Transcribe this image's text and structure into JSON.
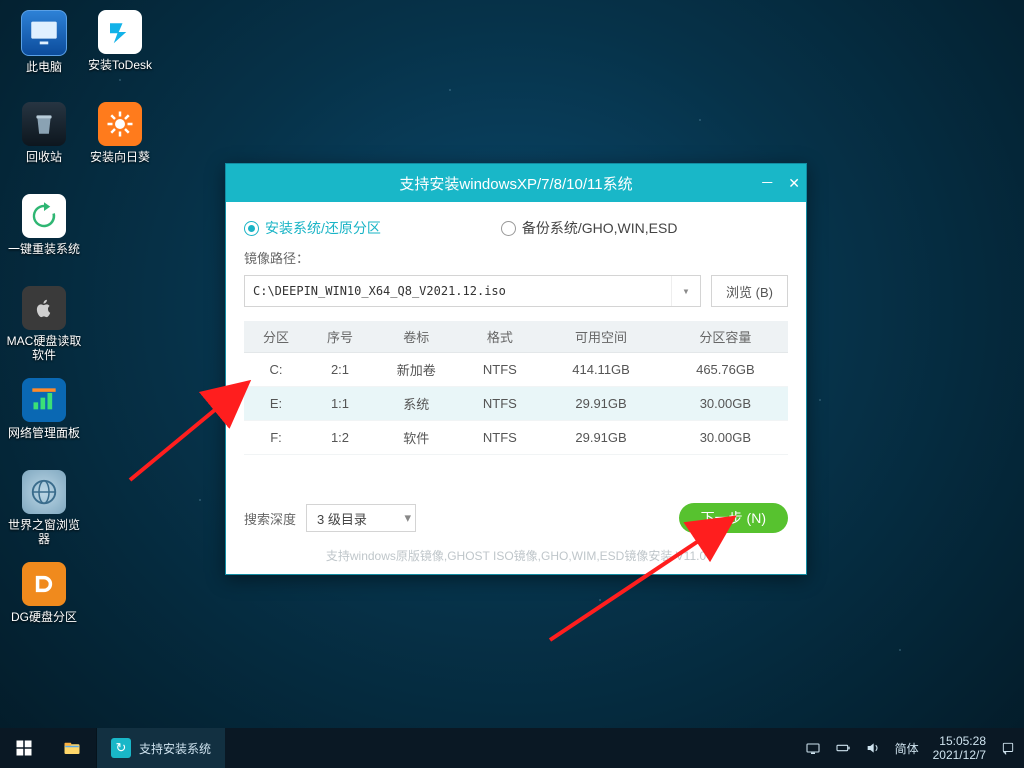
{
  "desktop_icons": {
    "col1": [
      "此电脑",
      "回收站",
      "一键重装系统",
      "MAC硬盘读取软件",
      "网络管理面板",
      "世界之窗浏览器",
      "DG硬盘分区"
    ],
    "col2": [
      "安装ToDesk",
      "安装向日葵"
    ]
  },
  "window": {
    "title": "支持安装windowsXP/7/8/10/11系统",
    "opt_install": "安装系统/还原分区",
    "opt_backup": "备份系统/GHO,WIN,ESD",
    "path_label": "镜像路径：",
    "path_value": "C:\\DEEPIN_WIN10_X64_Q8_V2021.12.iso",
    "browse": "浏览 (B)",
    "headers": [
      "分区",
      "序号",
      "卷标",
      "格式",
      "可用空间",
      "分区容量"
    ],
    "rows": [
      {
        "p": "C:",
        "n": "2:1",
        "v": "新加卷",
        "f": "NTFS",
        "free": "414.11GB",
        "cap": "465.76GB",
        "sel": false
      },
      {
        "p": "E:",
        "n": "1:1",
        "v": "系统",
        "f": "NTFS",
        "free": "29.91GB",
        "cap": "30.00GB",
        "sel": true
      },
      {
        "p": "F:",
        "n": "1:2",
        "v": "软件",
        "f": "NTFS",
        "free": "29.91GB",
        "cap": "30.00GB",
        "sel": false
      }
    ],
    "depth_label": "搜索深度",
    "depth_value": "3 级目录",
    "next": "下一步 (N)",
    "hint": "支持windows原版镜像,GHOST ISO镜像,GHO,WIM,ESD镜像安装   V11.0"
  },
  "taskbar": {
    "task_label": "支持安装系统",
    "ime": "简体",
    "time": "15:05:28",
    "date": "2021/12/7"
  }
}
